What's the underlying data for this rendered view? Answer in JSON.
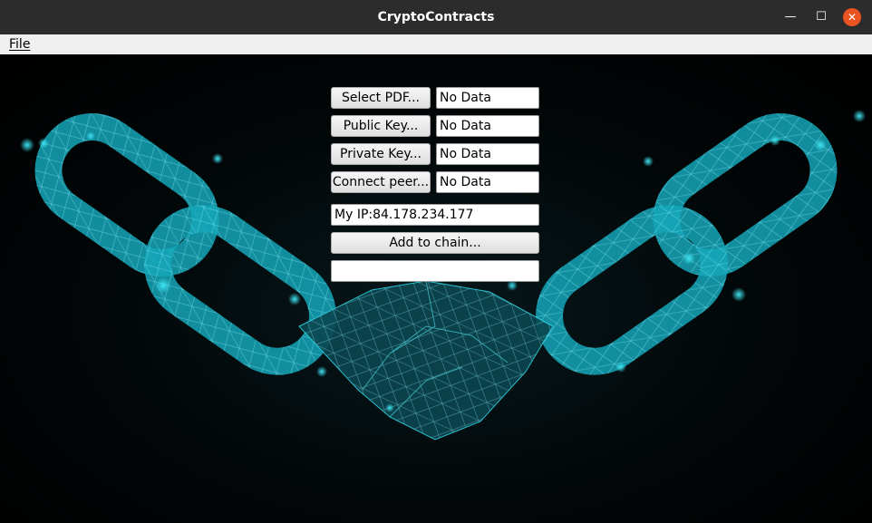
{
  "window": {
    "title": "CryptoContracts",
    "minimize_glyph": "—",
    "maximize_glyph": "☐",
    "close_glyph": "✕"
  },
  "menu": {
    "file": "File"
  },
  "controls": {
    "select_pdf": {
      "button": "Select PDF...",
      "value": "No Data"
    },
    "public_key": {
      "button": "Public Key...",
      "value": "No Data"
    },
    "private_key": {
      "button": "Private Key...",
      "value": "No Data"
    },
    "connect_peer": {
      "button": "Connect peer...",
      "value": "No Data"
    },
    "my_ip": "My IP:84.178.234.177",
    "add_to_chain": "Add to chain...",
    "status": ""
  },
  "colors": {
    "accent": "#1fb7c9",
    "close_button": "#e95420",
    "titlebar": "#2c2c2c"
  },
  "icons": {
    "background": "chain-links-handshake-image"
  }
}
